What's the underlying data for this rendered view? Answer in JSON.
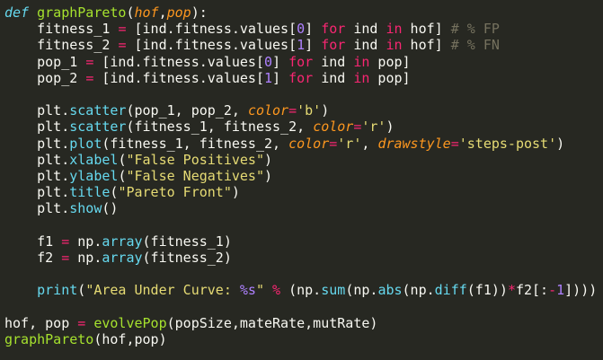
{
  "editor": {
    "lines": [
      [
        {
          "t": "def",
          "c": "kw-def"
        },
        {
          "t": " ",
          "c": "plain"
        },
        {
          "t": "graphPareto",
          "c": "func"
        },
        {
          "t": "(",
          "c": "plain"
        },
        {
          "t": "hof",
          "c": "param"
        },
        {
          "t": ",",
          "c": "plain"
        },
        {
          "t": "pop",
          "c": "param"
        },
        {
          "t": "):",
          "c": "plain"
        }
      ],
      [
        {
          "t": "    fitness_1 ",
          "c": "plain"
        },
        {
          "t": "=",
          "c": "op"
        },
        {
          "t": " [ind.fitness.values[",
          "c": "plain"
        },
        {
          "t": "0",
          "c": "num"
        },
        {
          "t": "] ",
          "c": "plain"
        },
        {
          "t": "for",
          "c": "op"
        },
        {
          "t": " ind ",
          "c": "plain"
        },
        {
          "t": "in",
          "c": "op"
        },
        {
          "t": " hof] ",
          "c": "plain"
        },
        {
          "t": "# % FP",
          "c": "comment"
        }
      ],
      [
        {
          "t": "    fitness_2 ",
          "c": "plain"
        },
        {
          "t": "=",
          "c": "op"
        },
        {
          "t": " [ind.fitness.values[",
          "c": "plain"
        },
        {
          "t": "1",
          "c": "num"
        },
        {
          "t": "] ",
          "c": "plain"
        },
        {
          "t": "for",
          "c": "op"
        },
        {
          "t": " ind ",
          "c": "plain"
        },
        {
          "t": "in",
          "c": "op"
        },
        {
          "t": " hof] ",
          "c": "plain"
        },
        {
          "t": "# % FN",
          "c": "comment"
        }
      ],
      [
        {
          "t": "    pop_1 ",
          "c": "plain"
        },
        {
          "t": "=",
          "c": "op"
        },
        {
          "t": " [ind.fitness.values[",
          "c": "plain"
        },
        {
          "t": "0",
          "c": "num"
        },
        {
          "t": "] ",
          "c": "plain"
        },
        {
          "t": "for",
          "c": "op"
        },
        {
          "t": " ind ",
          "c": "plain"
        },
        {
          "t": "in",
          "c": "op"
        },
        {
          "t": " pop]",
          "c": "plain"
        }
      ],
      [
        {
          "t": "    pop_2 ",
          "c": "plain"
        },
        {
          "t": "=",
          "c": "op"
        },
        {
          "t": " [ind.fitness.values[",
          "c": "plain"
        },
        {
          "t": "1",
          "c": "num"
        },
        {
          "t": "] ",
          "c": "plain"
        },
        {
          "t": "for",
          "c": "op"
        },
        {
          "t": " ind ",
          "c": "plain"
        },
        {
          "t": "in",
          "c": "op"
        },
        {
          "t": " pop]",
          "c": "plain"
        }
      ],
      [],
      [
        {
          "t": "    plt.",
          "c": "plain"
        },
        {
          "t": "scatter",
          "c": "builtin"
        },
        {
          "t": "(pop_1, pop_2, ",
          "c": "plain"
        },
        {
          "t": "color",
          "c": "kwarg"
        },
        {
          "t": "=",
          "c": "op"
        },
        {
          "t": "'b'",
          "c": "string"
        },
        {
          "t": ")",
          "c": "plain"
        }
      ],
      [
        {
          "t": "    plt.",
          "c": "plain"
        },
        {
          "t": "scatter",
          "c": "builtin"
        },
        {
          "t": "(fitness_1, fitness_2, ",
          "c": "plain"
        },
        {
          "t": "color",
          "c": "kwarg"
        },
        {
          "t": "=",
          "c": "op"
        },
        {
          "t": "'r'",
          "c": "string"
        },
        {
          "t": ")",
          "c": "plain"
        }
      ],
      [
        {
          "t": "    plt.",
          "c": "plain"
        },
        {
          "t": "plot",
          "c": "builtin"
        },
        {
          "t": "(fitness_1, fitness_2, ",
          "c": "plain"
        },
        {
          "t": "color",
          "c": "kwarg"
        },
        {
          "t": "=",
          "c": "op"
        },
        {
          "t": "'r'",
          "c": "string"
        },
        {
          "t": ", ",
          "c": "plain"
        },
        {
          "t": "drawstyle",
          "c": "kwarg"
        },
        {
          "t": "=",
          "c": "op"
        },
        {
          "t": "'steps-post'",
          "c": "string"
        },
        {
          "t": ")",
          "c": "plain"
        }
      ],
      [
        {
          "t": "    plt.",
          "c": "plain"
        },
        {
          "t": "xlabel",
          "c": "builtin"
        },
        {
          "t": "(",
          "c": "plain"
        },
        {
          "t": "\"False Positives\"",
          "c": "string"
        },
        {
          "t": ")",
          "c": "plain"
        }
      ],
      [
        {
          "t": "    plt.",
          "c": "plain"
        },
        {
          "t": "ylabel",
          "c": "builtin"
        },
        {
          "t": "(",
          "c": "plain"
        },
        {
          "t": "\"False Negatives\"",
          "c": "string"
        },
        {
          "t": ")",
          "c": "plain"
        }
      ],
      [
        {
          "t": "    plt.",
          "c": "plain"
        },
        {
          "t": "title",
          "c": "builtin"
        },
        {
          "t": "(",
          "c": "plain"
        },
        {
          "t": "\"Pareto Front\"",
          "c": "string"
        },
        {
          "t": ")",
          "c": "plain"
        }
      ],
      [
        {
          "t": "    plt.",
          "c": "plain"
        },
        {
          "t": "show",
          "c": "builtin"
        },
        {
          "t": "()",
          "c": "plain"
        }
      ],
      [],
      [
        {
          "t": "    f1 ",
          "c": "plain"
        },
        {
          "t": "=",
          "c": "op"
        },
        {
          "t": " np.",
          "c": "plain"
        },
        {
          "t": "array",
          "c": "builtin"
        },
        {
          "t": "(fitness_1)",
          "c": "plain"
        }
      ],
      [
        {
          "t": "    f2 ",
          "c": "plain"
        },
        {
          "t": "=",
          "c": "op"
        },
        {
          "t": " np.",
          "c": "plain"
        },
        {
          "t": "array",
          "c": "builtin"
        },
        {
          "t": "(fitness_2)",
          "c": "plain"
        }
      ],
      [],
      [
        {
          "t": "    ",
          "c": "plain"
        },
        {
          "t": "print",
          "c": "builtin"
        },
        {
          "t": "(",
          "c": "plain"
        },
        {
          "t": "\"Area Under Curve: ",
          "c": "string"
        },
        {
          "t": "%s",
          "c": "fmt"
        },
        {
          "t": "\"",
          "c": "string"
        },
        {
          "t": " ",
          "c": "plain"
        },
        {
          "t": "%",
          "c": "op"
        },
        {
          "t": " (np.",
          "c": "plain"
        },
        {
          "t": "sum",
          "c": "builtin"
        },
        {
          "t": "(np.",
          "c": "plain"
        },
        {
          "t": "abs",
          "c": "builtin"
        },
        {
          "t": "(np.",
          "c": "plain"
        },
        {
          "t": "diff",
          "c": "builtin"
        },
        {
          "t": "(f1))",
          "c": "plain"
        },
        {
          "t": "*",
          "c": "op"
        },
        {
          "t": "f2[:",
          "c": "plain"
        },
        {
          "t": "-",
          "c": "op"
        },
        {
          "t": "1",
          "c": "num"
        },
        {
          "t": "])))",
          "c": "plain"
        }
      ],
      [],
      [
        {
          "t": "hof, pop ",
          "c": "plain"
        },
        {
          "t": "=",
          "c": "op"
        },
        {
          "t": " ",
          "c": "plain"
        },
        {
          "t": "evolvePop",
          "c": "func"
        },
        {
          "t": "(popSize,mateRate,mutRate)",
          "c": "plain"
        }
      ],
      [
        {
          "t": "graphPareto",
          "c": "func"
        },
        {
          "t": "(hof,pop)",
          "c": "plain"
        }
      ]
    ]
  }
}
